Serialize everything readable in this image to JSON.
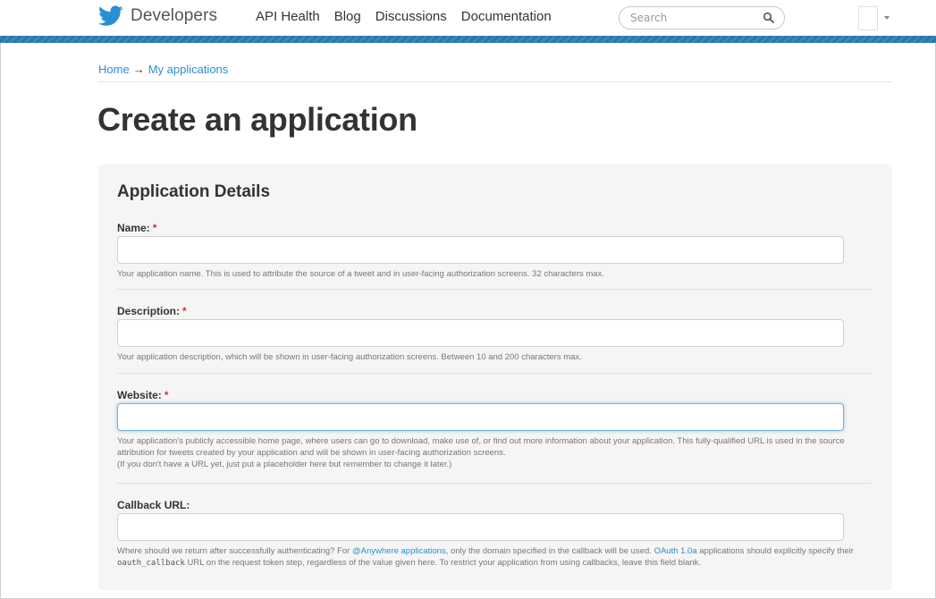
{
  "header": {
    "logo_text": "Developers",
    "nav": [
      "API Health",
      "Blog",
      "Discussions",
      "Documentation"
    ],
    "search_placeholder": "Search",
    "accent": "#2a7eb0"
  },
  "breadcrumb": {
    "home": "Home",
    "separator": "→",
    "current": "My applications"
  },
  "page_title": "Create an application",
  "panel": {
    "title": "Application Details",
    "fields": {
      "name": {
        "label": "Name:",
        "required": "*",
        "value": "",
        "help": "Your application name. This is used to attribute the source of a tweet and in user-facing authorization screens. 32 characters max."
      },
      "description": {
        "label": "Description:",
        "required": "*",
        "value": "",
        "help": "Your application description, which will be shown in user-facing authorization screens. Between 10 and 200 characters max."
      },
      "website": {
        "label": "Website:",
        "required": "*",
        "value": "",
        "help_1": "Your application's publicly accessible home page, where users can go to download, make use of, or find out more information about your application. This fully-qualified URL is used in the source attribution for tweets created by your application and will be shown in user-facing authorization screens.",
        "help_2": "(If you don't have a URL yet, just put a placeholder here but remember to change it later.)"
      },
      "callback": {
        "label": "Callback URL:",
        "value": "",
        "help_a": "Where should we return after successfully authenticating? For ",
        "help_link_1": "@Anywhere applications",
        "help_b": ", only the domain specified in the callback will be used. ",
        "help_link_2": "OAuth 1.0a",
        "help_c": " applications should explicitly specify their ",
        "help_code": "oauth_callback",
        "help_d": " URL on the request token step, regardless of the value given here. To restrict your application from using callbacks, leave this field blank."
      }
    }
  },
  "icons": {
    "logo": "twitter-bird-icon",
    "search": "magnifier-icon",
    "menu": "caret-down-icon"
  }
}
